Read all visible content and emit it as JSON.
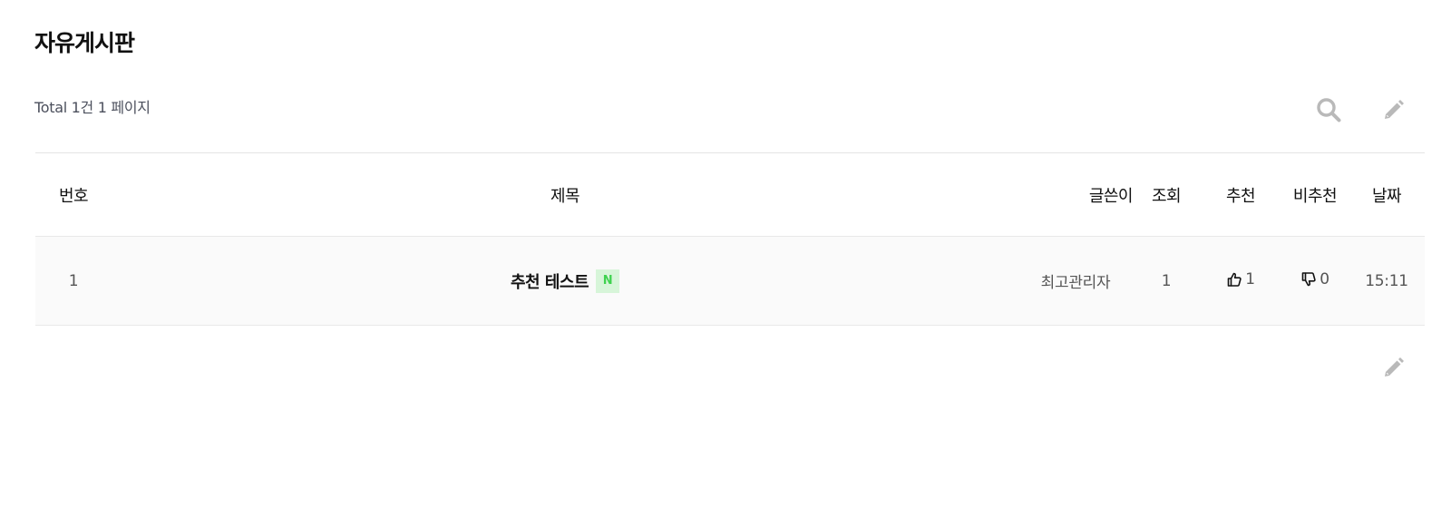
{
  "board": {
    "title": "자유게시판",
    "total_text": "Total 1건 1 페이지"
  },
  "toolbar": {
    "search_icon": "search-icon",
    "write_icon": "pencil-icon"
  },
  "table": {
    "headers": {
      "num": "번호",
      "subject": "제목",
      "writer": "글쓴이",
      "hit": "조회",
      "good": "추천",
      "nogood": "비추천",
      "date": "날짜"
    },
    "rows": [
      {
        "num": "1",
        "subject": "추천 테스트",
        "badge": "N",
        "writer": "최고관리자",
        "hit": "1",
        "good": "1",
        "nogood": "0",
        "date": "15:11"
      }
    ]
  },
  "colors": {
    "badge_bg": "#d7f5d9",
    "badge_text": "#3fd24f",
    "icon_gray": "#b9b9b9",
    "row_bg": "#fafafa"
  }
}
